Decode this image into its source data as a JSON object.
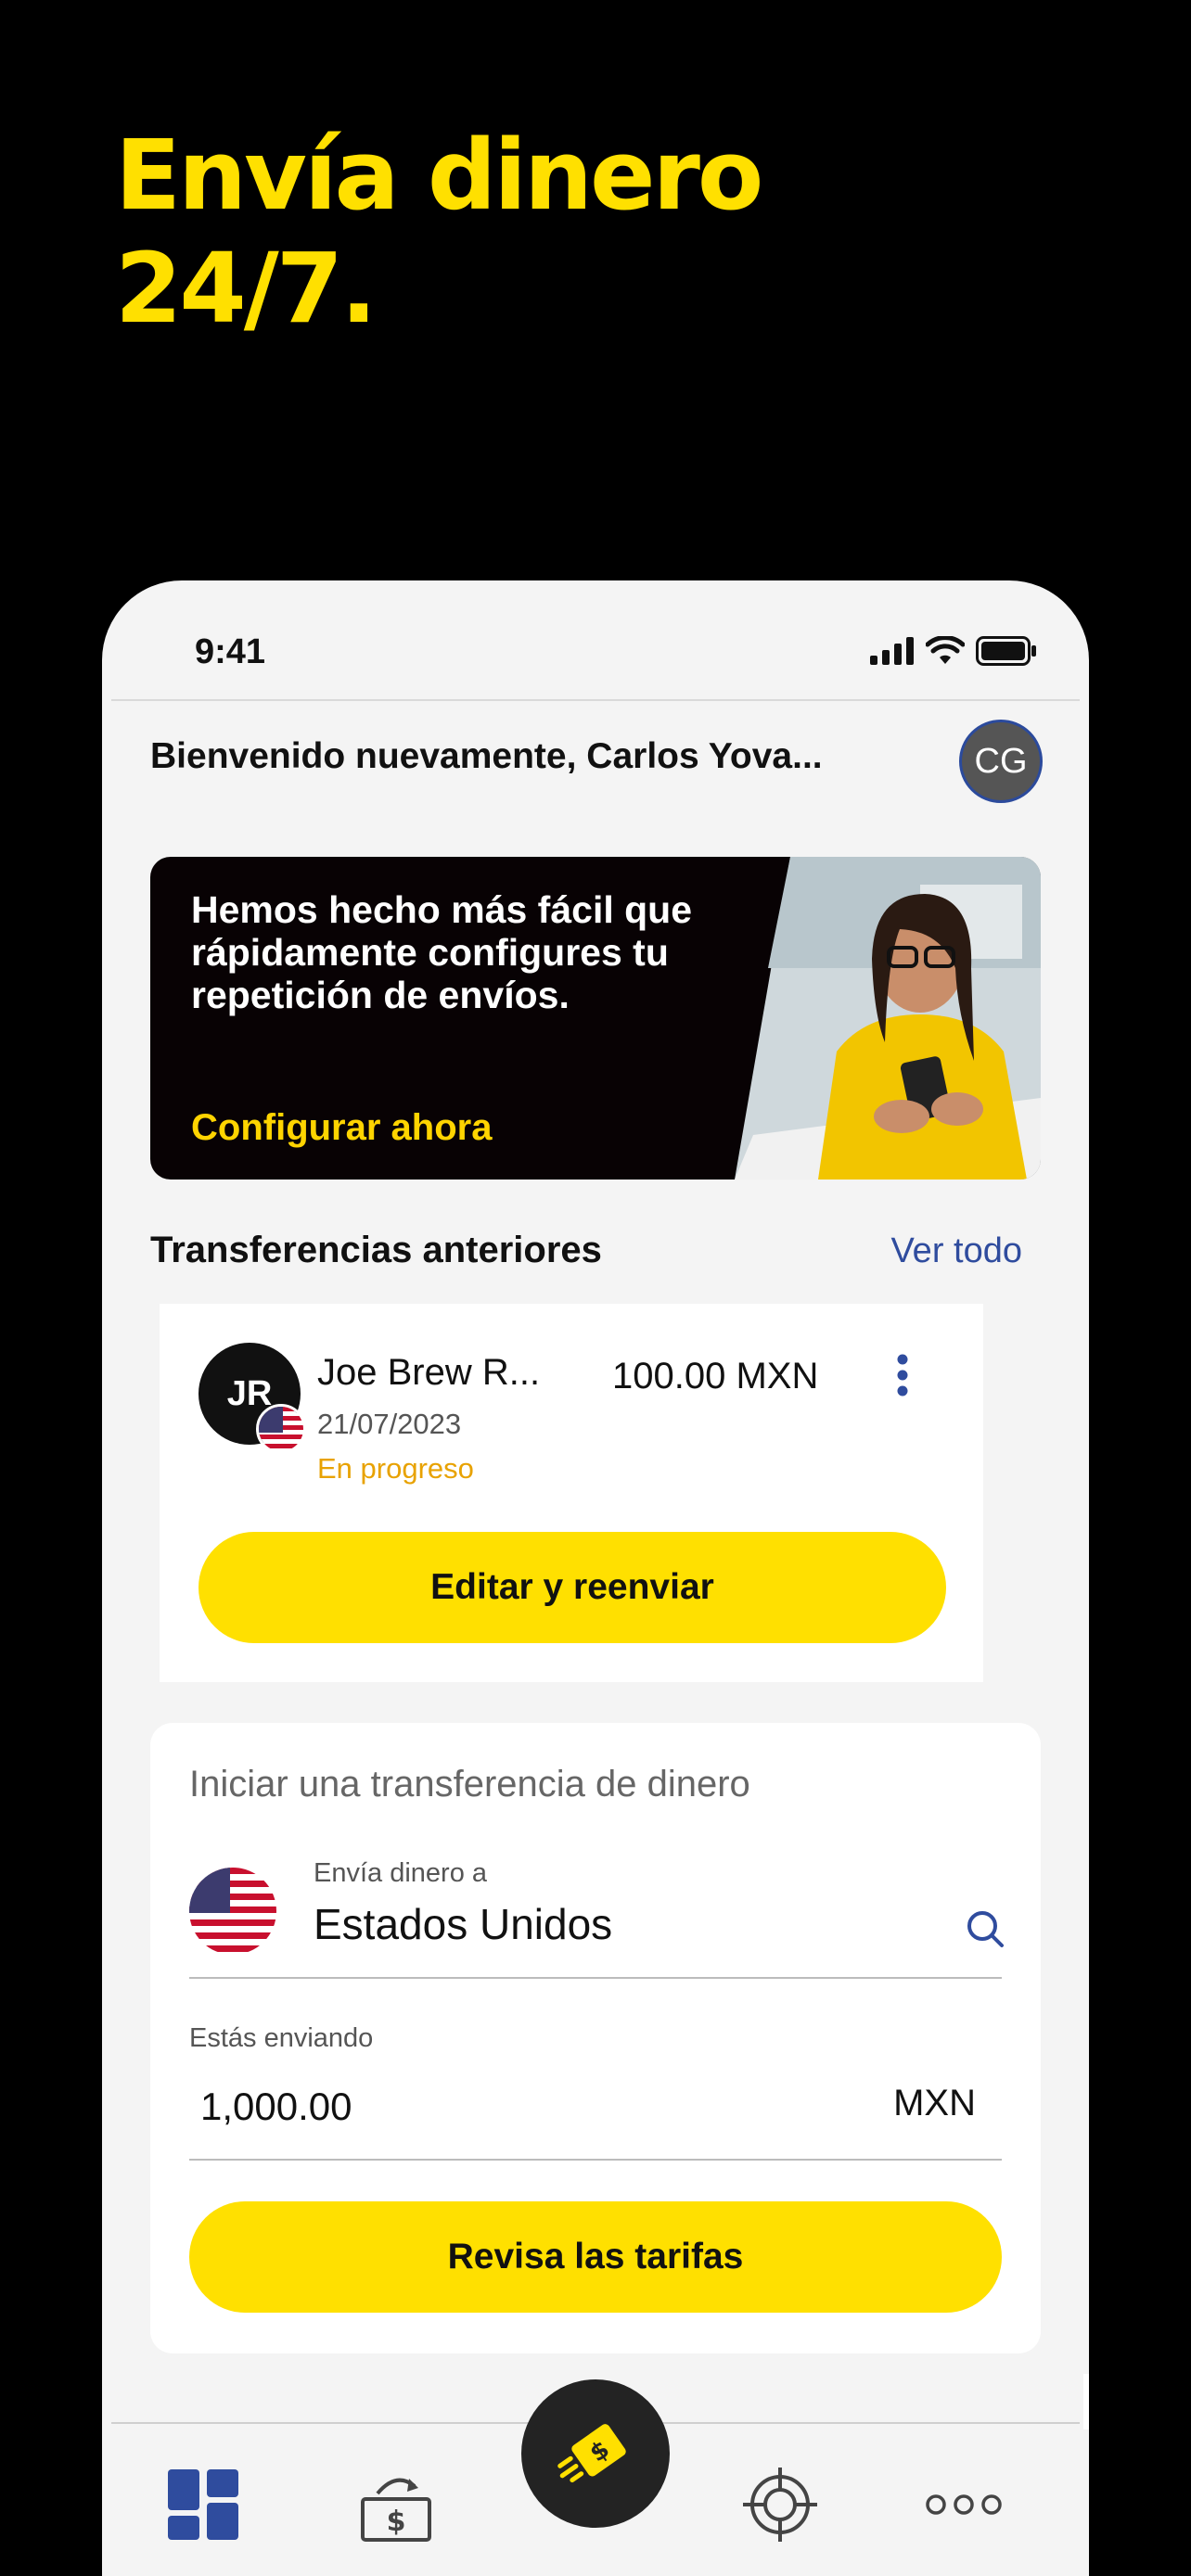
{
  "headline": {
    "line1": "Envía dinero",
    "line2": "24/7."
  },
  "status_bar": {
    "time": "9:41"
  },
  "header": {
    "welcome": "Bienvenido nuevamente, Carlos Yova...",
    "avatar_initials": "CG"
  },
  "banner": {
    "text": "Hemos hecho más fácil que rápidamente configures tu repetición de envíos.",
    "cta": "Configurar ahora"
  },
  "previous_transfers": {
    "title": "Transferencias anteriores",
    "see_all": "Ver todo",
    "item": {
      "initials": "JR",
      "name": "Joe Brew R...",
      "amount": "100.00 MXN",
      "date": "21/07/2023",
      "status": "En progreso",
      "action": "Editar y reenviar"
    }
  },
  "start_transfer": {
    "title": "Iniciar una transferencia de dinero",
    "country_label": "Envía dinero a",
    "country_value": "Estados Unidos",
    "sending_label": "Estás enviando",
    "sending_value": "1,000.00",
    "currency": "MXN",
    "action": "Revisa las tarifas"
  },
  "tab_bar": {
    "items": [
      "dashboard-icon",
      "transfer-money-icon",
      "send-money-icon",
      "target-icon",
      "more-icon"
    ]
  },
  "colors": {
    "brand_yellow": "#FFE000",
    "link_blue": "#2f4c9e",
    "status_orange": "#E8A200"
  }
}
